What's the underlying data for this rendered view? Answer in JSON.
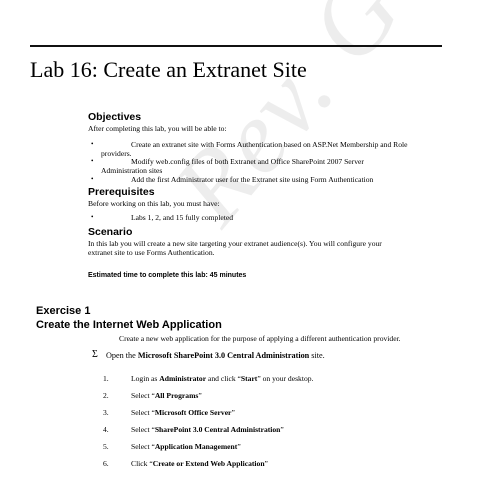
{
  "document": {
    "title": "Lab 16: Create an Extranet Site",
    "watermark": "Rev. G",
    "objectives": {
      "heading": "Objectives",
      "intro": "After completing this lab, you will be able to:",
      "items": [
        {
          "line1": "Create an extranet site with Forms Authentication based on ASP.Net Membership and Role",
          "line2": "providers."
        },
        {
          "line1": "Modify web.config files of both Extranet and Office SharePoint 2007 Server",
          "line2": "Administration sites"
        },
        {
          "line1": "Add the first Administrator user for the Extranet site using Form Authentication",
          "line2": ""
        }
      ]
    },
    "prerequisites": {
      "heading": "Prerequisites",
      "intro": "Before working on this lab, you must have:",
      "items": [
        "Labs 1, 2, and 15 fully completed"
      ]
    },
    "scenario": {
      "heading": "Scenario",
      "line1": "In this lab you will create a new site targeting your extranet audience(s). You will configure your",
      "line2": "extranet site to use Forms Authentication."
    },
    "estimated_time": "Estimated time to complete this lab: 45 minutes",
    "exercise": {
      "number": "Exercise 1",
      "title": "Create the Internet Web Application",
      "description": "Create a new web application for the purpose of applying a different authentication provider.",
      "task": {
        "symbol": "Σ",
        "prefix": "Open the ",
        "bold": "Microsoft SharePoint 3.0 Central Administration",
        "suffix": " site."
      },
      "steps": [
        {
          "num": "1.",
          "pre": "Login as ",
          "bold": "Administrator",
          "mid": " and click “",
          "bold2": "Start",
          "post": "” on your desktop."
        },
        {
          "num": "2.",
          "pre": "Select “",
          "bold": "All Programs",
          "mid": "”",
          "bold2": "",
          "post": ""
        },
        {
          "num": "3.",
          "pre": "Select “",
          "bold": "Microsoft Office Server",
          "mid": "”",
          "bold2": "",
          "post": ""
        },
        {
          "num": "4.",
          "pre": "Select “",
          "bold": "SharePoint 3.0 Central Administration",
          "mid": "”",
          "bold2": "",
          "post": ""
        },
        {
          "num": "5.",
          "pre": "Select “",
          "bold": "Application Management",
          "mid": "”",
          "bold2": "",
          "post": ""
        },
        {
          "num": "6.",
          "pre": "Click “",
          "bold": "Create or Extend Web Application",
          "mid": "”",
          "bold2": "",
          "post": ""
        }
      ]
    }
  }
}
